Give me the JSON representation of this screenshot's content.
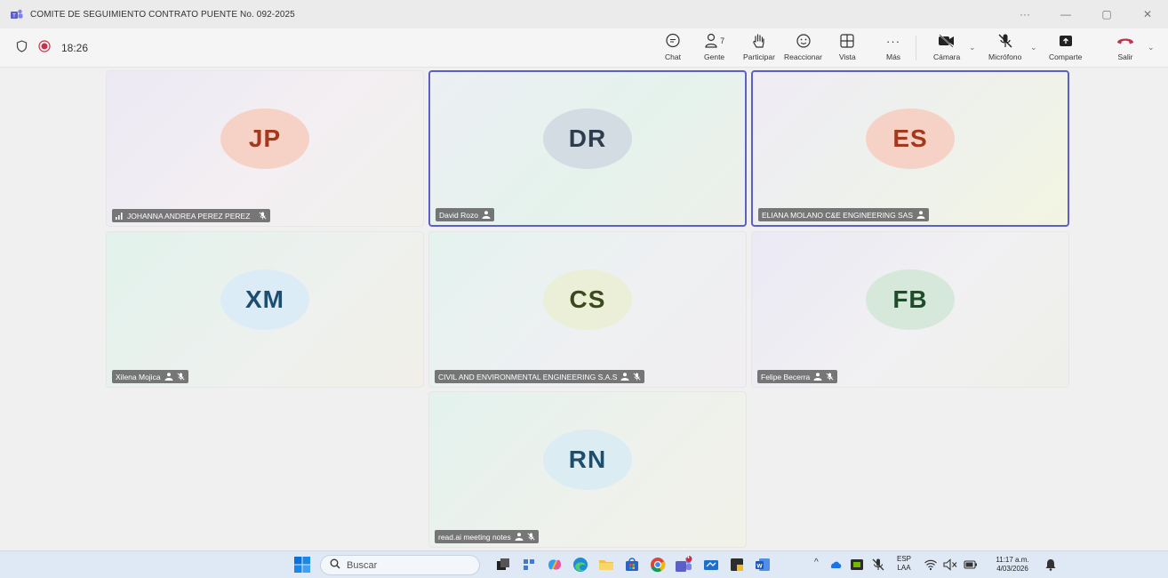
{
  "window": {
    "title": "COMITE DE SEGUIMIENTO CONTRATO PUENTE No. 092-2025",
    "controls": [
      "···",
      "—",
      "▢",
      "✕"
    ]
  },
  "meeting": {
    "elapsed": "18:26",
    "people_count": "7",
    "toolbar": {
      "chat": "Chat",
      "people": "Gente",
      "raise": "Participar",
      "react": "Reaccionar",
      "view": "Vista",
      "more": "Más",
      "camera": "Cámara",
      "mic": "Micrófono",
      "share": "Comparte",
      "leave": "Salir"
    }
  },
  "participants": [
    {
      "initials": "JP",
      "name": "JOHANNA ANDREA PEREZ PEREZ",
      "avatar_bg": "#f6d2c6",
      "initials_color": "#a4381c",
      "muted": true,
      "active": false
    },
    {
      "initials": "DR",
      "name": "David Rozo",
      "avatar_bg": "#d3dbe3",
      "initials_color": "#2e3d4e",
      "muted": false,
      "active": true
    },
    {
      "initials": "ES",
      "name": "ELIANA MOLANO C&E ENGINEERING SAS",
      "avatar_bg": "#f6d2c6",
      "initials_color": "#a4381c",
      "muted": false,
      "active": true
    },
    {
      "initials": "XM",
      "name": "Xilena Mojica",
      "avatar_bg": "#dcecf6",
      "initials_color": "#1d4e6e",
      "muted": true,
      "active": false
    },
    {
      "initials": "CS",
      "name": "CIVIL AND ENVIRONMENTAL ENGINEERING S.A.S",
      "avatar_bg": "#ebefd8",
      "initials_color": "#3b4a1e",
      "muted": true,
      "active": false
    },
    {
      "initials": "FB",
      "name": "Felipe Becerra",
      "avatar_bg": "#d6e8da",
      "initials_color": "#1e4d2b",
      "muted": true,
      "active": false
    },
    {
      "initials": "RN",
      "name": "read.ai meeting notes",
      "avatar_bg": "#dcecf3",
      "initials_color": "#1d4e6e",
      "muted": true,
      "active": false
    }
  ],
  "taskbar": {
    "search_label": "Buscar",
    "teams_badge": "4",
    "lang_top": "ESP",
    "lang_bottom": "LAA",
    "time": "11:17 a.m.",
    "date": "4/03/2026"
  },
  "colors": {
    "accent": "#5b5fc7",
    "leave_red": "#c4314b",
    "record_red": "#c4314b"
  }
}
